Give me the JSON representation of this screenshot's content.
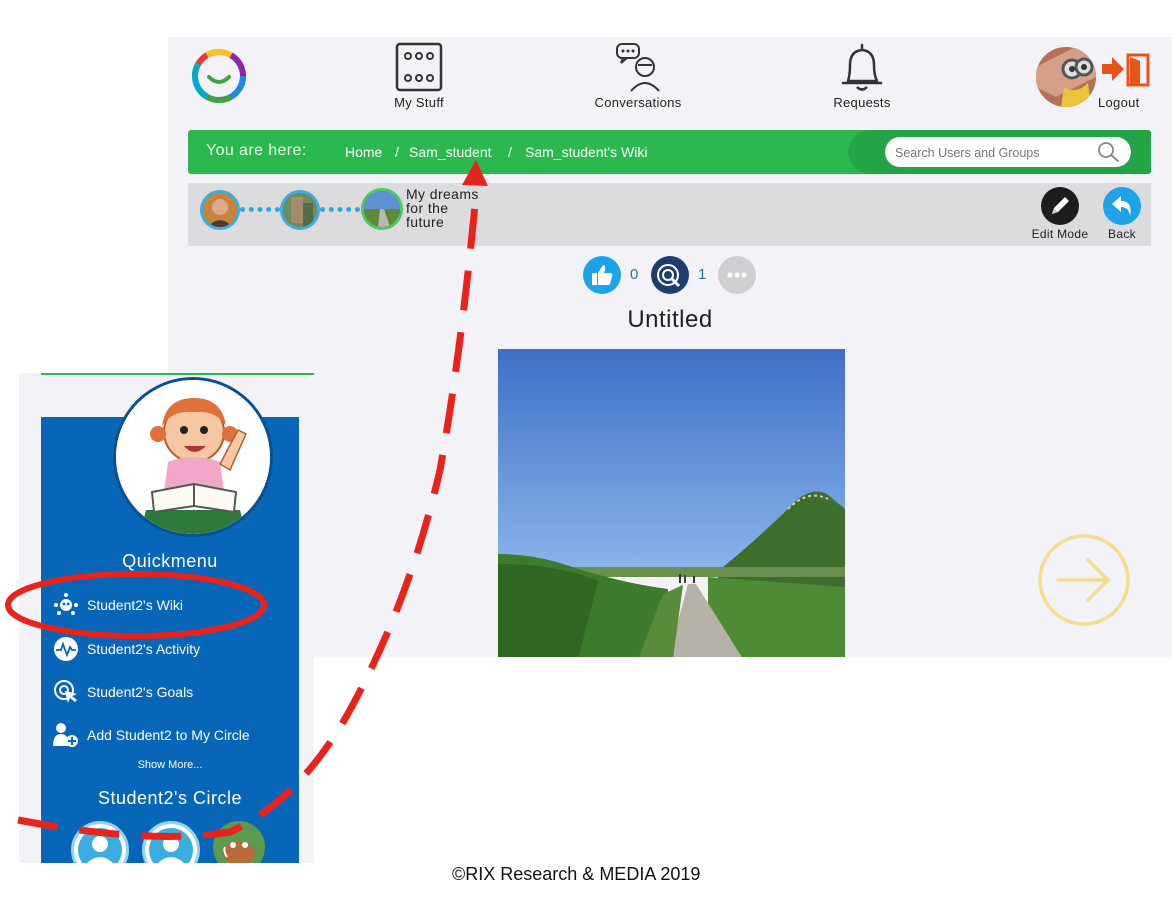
{
  "header": {
    "nav": [
      {
        "label": "My Stuff",
        "icon": "dice-icon"
      },
      {
        "label": "Conversations",
        "icon": "conversation-icon"
      },
      {
        "label": "Requests",
        "icon": "bell-icon"
      }
    ],
    "logout_label": "Logout"
  },
  "breadcrumb": {
    "prefix": "You are here:",
    "items": [
      "Home",
      "Sam_student",
      "Sam_student's Wiki"
    ],
    "separator": "/"
  },
  "search": {
    "placeholder": "Search Users and Groups"
  },
  "path": {
    "current_label_lines": [
      "My dreams",
      "for the",
      "future"
    ],
    "edit_label": "Edit Mode",
    "back_label": "Back"
  },
  "reactions": {
    "likes": "0",
    "links": "1"
  },
  "page": {
    "title": "Untitled"
  },
  "quickmenu": {
    "title": "Quickmenu",
    "items": [
      {
        "label": "Student2's Wiki",
        "icon": "wiki-icon"
      },
      {
        "label": "Student2's Activity",
        "icon": "activity-icon"
      },
      {
        "label": "Student2's Goals",
        "icon": "goals-icon"
      },
      {
        "label": "Add Student2 to My Circle",
        "icon": "add-user-icon"
      }
    ],
    "show_more": "Show More...",
    "circle_title": "Student2's Circle"
  },
  "footer": {
    "copyright": "©RIX  Research & MEDIA 2019"
  },
  "colors": {
    "green_bar": "#2bb84f",
    "blue_panel": "#0866b8",
    "annotation_red": "#e8231c",
    "accent_blue": "#2aa9e0"
  }
}
